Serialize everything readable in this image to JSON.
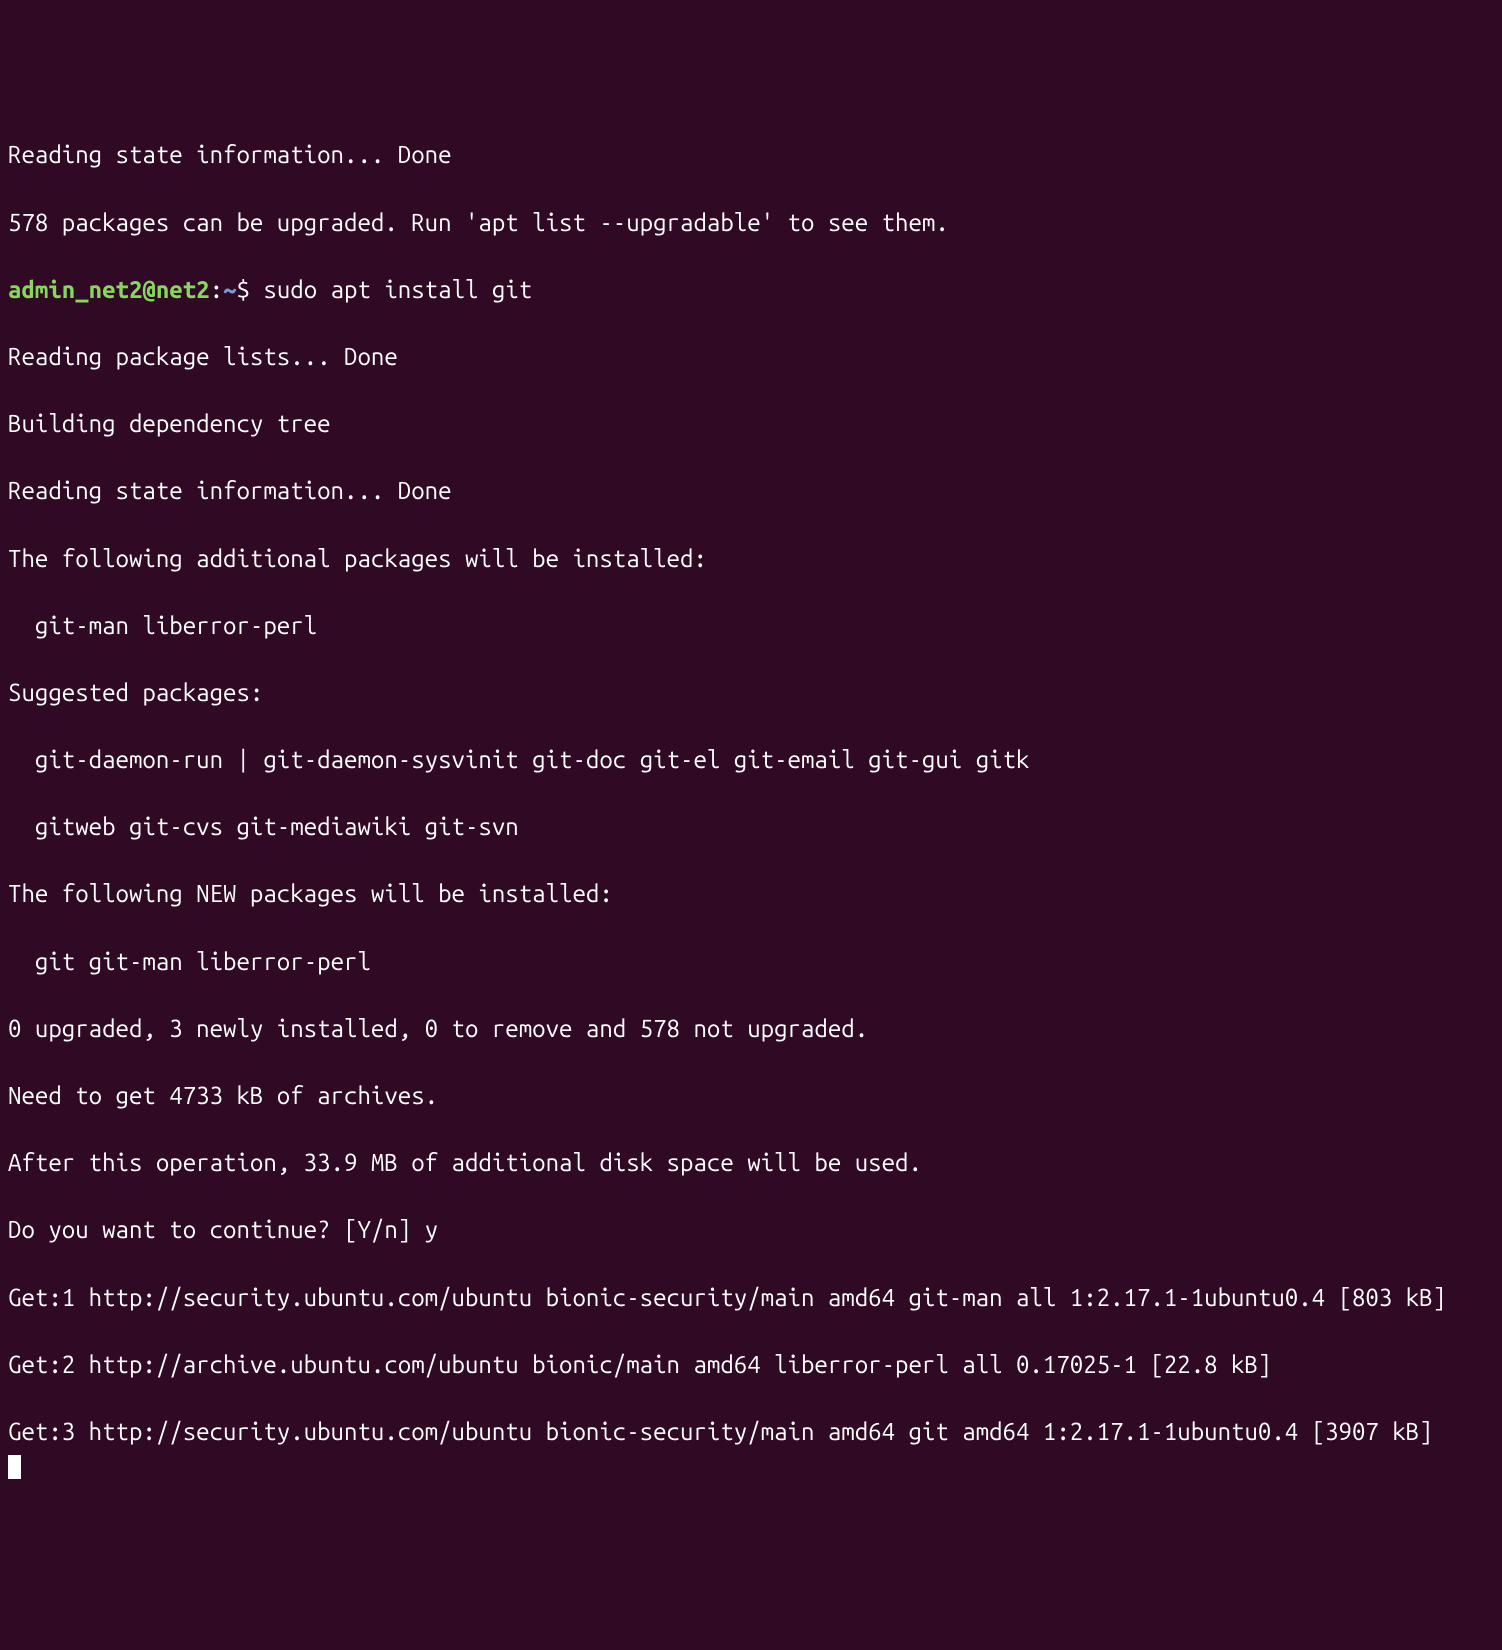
{
  "terminal": {
    "lines_pre": [
      "Reading state information... Done",
      "578 packages can be upgraded. Run 'apt list --upgradable' to see them."
    ],
    "prompt": {
      "user_host": "admin_net2@net2",
      "sep": ":",
      "path": "~",
      "dollar": "$ "
    },
    "command": "sudo apt install git",
    "lines_post": [
      "Reading package lists... Done",
      "Building dependency tree",
      "Reading state information... Done",
      "The following additional packages will be installed:",
      "  git-man liberror-perl",
      "Suggested packages:",
      "  git-daemon-run | git-daemon-sysvinit git-doc git-el git-email git-gui gitk",
      "  gitweb git-cvs git-mediawiki git-svn",
      "The following NEW packages will be installed:",
      "  git git-man liberror-perl",
      "0 upgraded, 3 newly installed, 0 to remove and 578 not upgraded.",
      "Need to get 4733 kB of archives.",
      "After this operation, 33.9 MB of additional disk space will be used.",
      "Do you want to continue? [Y/n] y",
      "Get:1 http://security.ubuntu.com/ubuntu bionic-security/main amd64 git-man all 1:2.17.1-1ubuntu0.4 [803 kB]",
      "Get:2 http://archive.ubuntu.com/ubuntu bionic/main amd64 liberror-perl all 0.17025-1 [22.8 kB]",
      "Get:3 http://security.ubuntu.com/ubuntu bionic-security/main amd64 git amd64 1:2.17.1-1ubuntu0.4 [3907 kB]"
    ]
  }
}
